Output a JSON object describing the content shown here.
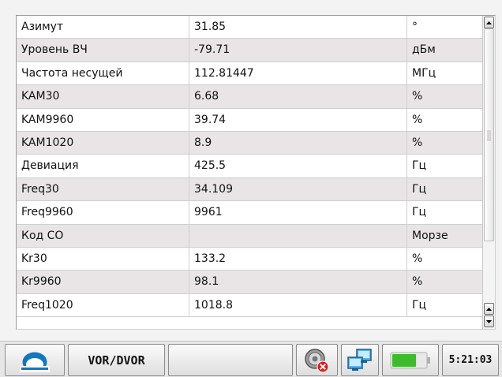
{
  "table": {
    "rows": [
      {
        "name": "Азимут",
        "value": "31.85",
        "unit": "°"
      },
      {
        "name": "Уровень ВЧ",
        "value": "-79.71",
        "unit": "дБм"
      },
      {
        "name": "Частота несущей",
        "value": "112.81447",
        "unit": "МГц"
      },
      {
        "name": "KAM30",
        "value": "6.68",
        "unit": "%"
      },
      {
        "name": "KAM9960",
        "value": "39.74",
        "unit": "%"
      },
      {
        "name": "KAM1020",
        "value": "8.9",
        "unit": "%"
      },
      {
        "name": "Девиация",
        "value": "425.5",
        "unit": "Гц"
      },
      {
        "name": "Freq30",
        "value": "34.109",
        "unit": "Гц"
      },
      {
        "name": "Freq9960",
        "value": "9961",
        "unit": "Гц"
      },
      {
        "name": "Код СО",
        "value": "",
        "unit": "Морзе"
      },
      {
        "name": "Kr30",
        "value": "133.2",
        "unit": "%"
      },
      {
        "name": "Kr9960",
        "value": "98.1",
        "unit": "%"
      },
      {
        "name": "Freq1020",
        "value": "1018.8",
        "unit": "Гц"
      }
    ]
  },
  "taskbar": {
    "mode_label": "VOR/DVOR",
    "clock": "5:21:03",
    "battery_level": 0.7
  },
  "colors": {
    "logo": "#1177c0",
    "battery_fill": "#3dbb2c",
    "row_alt": "#e9e5e7",
    "error_badge": "#d42020"
  },
  "icons": [
    "app-logo-icon",
    "speaker-error-icon",
    "network-icon",
    "battery-icon",
    "scroll-up-arrow-icon",
    "scroll-down-arrow-icon"
  ]
}
